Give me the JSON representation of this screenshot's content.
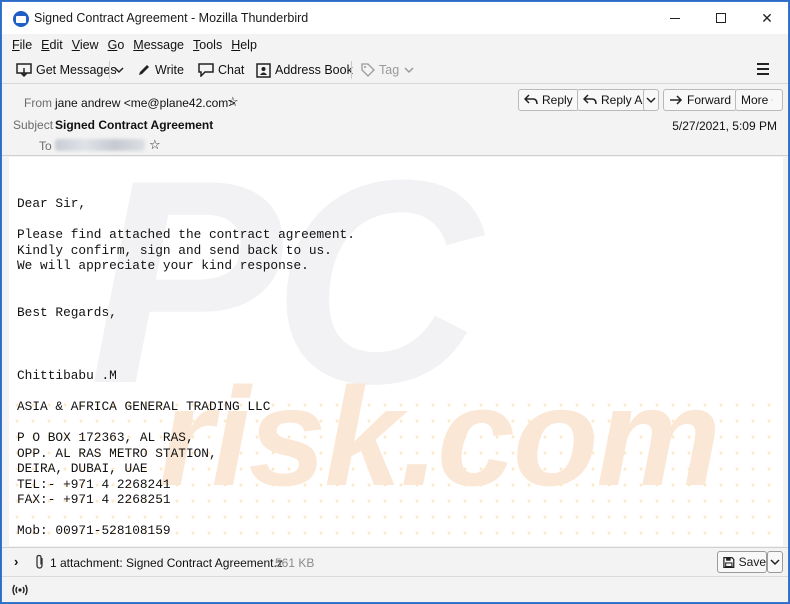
{
  "window": {
    "title": "Signed Contract Agreement - Mozilla Thunderbird",
    "minimize": "minimize",
    "maximize": "maximize",
    "close": "✕"
  },
  "menu": {
    "items": [
      {
        "label": "File",
        "accel": "F",
        "rest": "ile"
      },
      {
        "label": "Edit",
        "accel": "E",
        "rest": "dit"
      },
      {
        "label": "View",
        "accel": "V",
        "rest": "iew"
      },
      {
        "label": "Go",
        "accel": "G",
        "rest": "o"
      },
      {
        "label": "Message",
        "accel": "M",
        "rest": "essage"
      },
      {
        "label": "Tools",
        "accel": "T",
        "rest": "ools"
      },
      {
        "label": "Help",
        "accel": "H",
        "rest": "elp"
      }
    ]
  },
  "toolbar": {
    "get_messages": "Get Messages",
    "write": "Write",
    "chat": "Chat",
    "address_book": "Address Book",
    "tag": "Tag"
  },
  "header": {
    "from_label": "From",
    "from_value": "jane andrew <me@plane42.com>",
    "subject_label": "Subject",
    "subject_value": "Signed Contract Agreement",
    "to_label": "To",
    "date": "5/27/2021, 5:09 PM",
    "buttons": {
      "reply": "Reply",
      "reply_all": "Reply All",
      "forward": "Forward",
      "more": "More"
    }
  },
  "body": {
    "text": "Dear Sir,\n\nPlease find attached the contract agreement.\nKindly confirm, sign and send back to us.\nWe will appreciate your kind response.\n\n\nBest Regards,\n\n\n\nChittibabu .M\n\nASIA & AFRICA GENERAL TRADING LLC\n\nP O BOX 172363, AL RAS,\nOPP. AL RAS METRO STATION,\nDEIRA, DUBAI, UAE\nTEL:- +971 4 2268241\nFAX:- +971 4 2268251\n\nMob: 00971-528108159",
    "watermark_top": "PC",
    "watermark_bottom": "risk.com"
  },
  "attachment": {
    "summary": "1 attachment: Signed Contract Agreement.z",
    "size": "561 KB",
    "save": "Save"
  },
  "icons": {
    "app": "thunderbird-icon",
    "get_messages": "download-icon",
    "write": "pencil-icon",
    "chat": "chat-bubble-icon",
    "address_book": "address-book-icon",
    "tag": "tag-icon",
    "menu": "hamburger-icon",
    "star": "star-icon",
    "reply": "reply-arrow-icon",
    "forward": "forward-arrow-icon",
    "attachment": "paperclip-icon",
    "save": "floppy-disk-icon",
    "status": "wifi-antenna-icon"
  }
}
